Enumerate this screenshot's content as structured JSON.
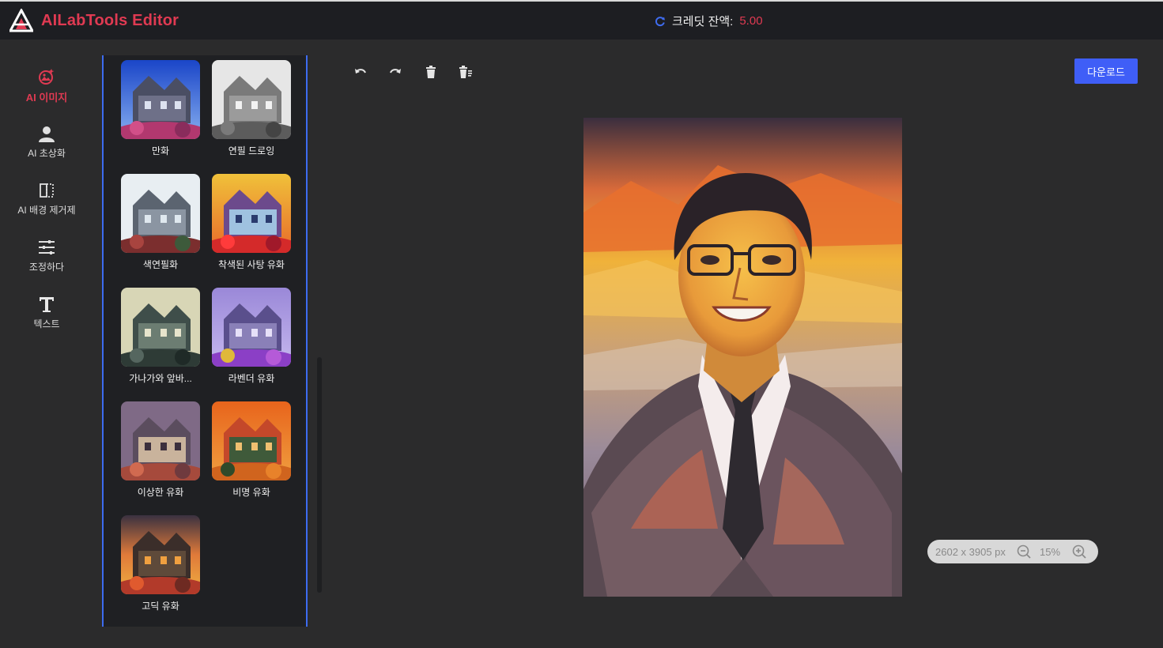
{
  "app": {
    "title": "AILabTools Editor",
    "brand_color": "#e03a52",
    "accent_color": "#3f5ef7"
  },
  "credit": {
    "label": "크레딧 잔액:",
    "value": "5.00",
    "icon": "refresh-icon"
  },
  "nav": [
    {
      "label": "AI 이미지",
      "icon": "ai-image-icon",
      "active": true
    },
    {
      "label": "AI 초상화",
      "icon": "portrait-icon",
      "active": false
    },
    {
      "label": "AI 배경 제거제",
      "icon": "background-remove-icon",
      "active": false
    },
    {
      "label": "조정하다",
      "icon": "sliders-icon",
      "active": false
    },
    {
      "label": "텍스트",
      "icon": "text-icon",
      "active": false
    }
  ],
  "filters": [
    {
      "label": "만화"
    },
    {
      "label": "연필 드로잉"
    },
    {
      "label": "색연필화"
    },
    {
      "label": "착색된 사탕 유화"
    },
    {
      "label": "가나가와 앞바..."
    },
    {
      "label": "라벤더 유화"
    },
    {
      "label": "이상한 유화"
    },
    {
      "label": "비명 유화"
    },
    {
      "label": "고딕 유화"
    }
  ],
  "toolbar": {
    "download_label": "다운로드",
    "tools": [
      "undo-icon",
      "redo-icon",
      "delete-icon",
      "delete-all-icon"
    ]
  },
  "zoom": {
    "dimensions": "2602 x 3905 px",
    "level": "15%"
  }
}
